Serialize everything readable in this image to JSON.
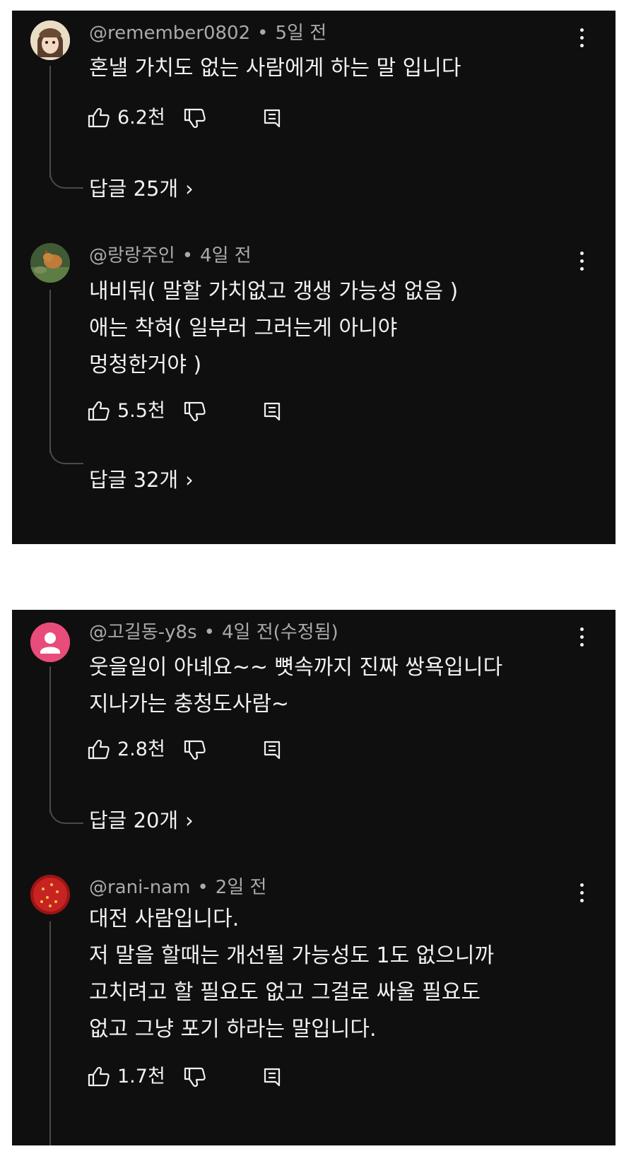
{
  "comments": [
    {
      "author": "@remember0802",
      "time": "5일 전",
      "lines": [
        "혼낼 가치도 없는 사람에게 하는 말 입니다"
      ],
      "likes": "6.2천",
      "replies_label": "답글 25개"
    },
    {
      "author": "@랑랑주인",
      "time": "4일 전",
      "lines": [
        "내비둬( 말할 가치없고 갱생 가능성 없음 )",
        "애는 착혀( 일부러 그러는게 아니야",
        "멍청한거야 )"
      ],
      "likes": "5.5천",
      "replies_label": "답글 32개"
    },
    {
      "author": "@고길동-y8s",
      "time": "4일 전(수정됨)",
      "lines": [
        "웃을일이 아녜요~~ 뼛속까지 진짜 쌍욕입니다",
        "지나가는 충청도사람~"
      ],
      "likes": "2.8천",
      "replies_label": "답글 20개"
    },
    {
      "author": "@rani-nam",
      "time": "2일 전",
      "lines": [
        "대전 사람입니다.",
        "저 말을 할때는 개선될 가능성도 1도 없으니까",
        "고치려고 할 필요도 없고 그걸로 싸울 필요도",
        "없고 그냥 포기 하라는 말입니다."
      ],
      "likes": "1.7천"
    }
  ],
  "dot_separator": "•",
  "reply_chevron": "›",
  "icons": {
    "like": "thumbs-up-icon",
    "dislike": "thumbs-down-icon",
    "reply": "reply-icon",
    "more": "more-vert-icon"
  },
  "colors": {
    "background": "#0f0f0f",
    "text": "#f1f1f1",
    "meta": "#aaaaaa",
    "default_avatar": "#e84c7a"
  }
}
